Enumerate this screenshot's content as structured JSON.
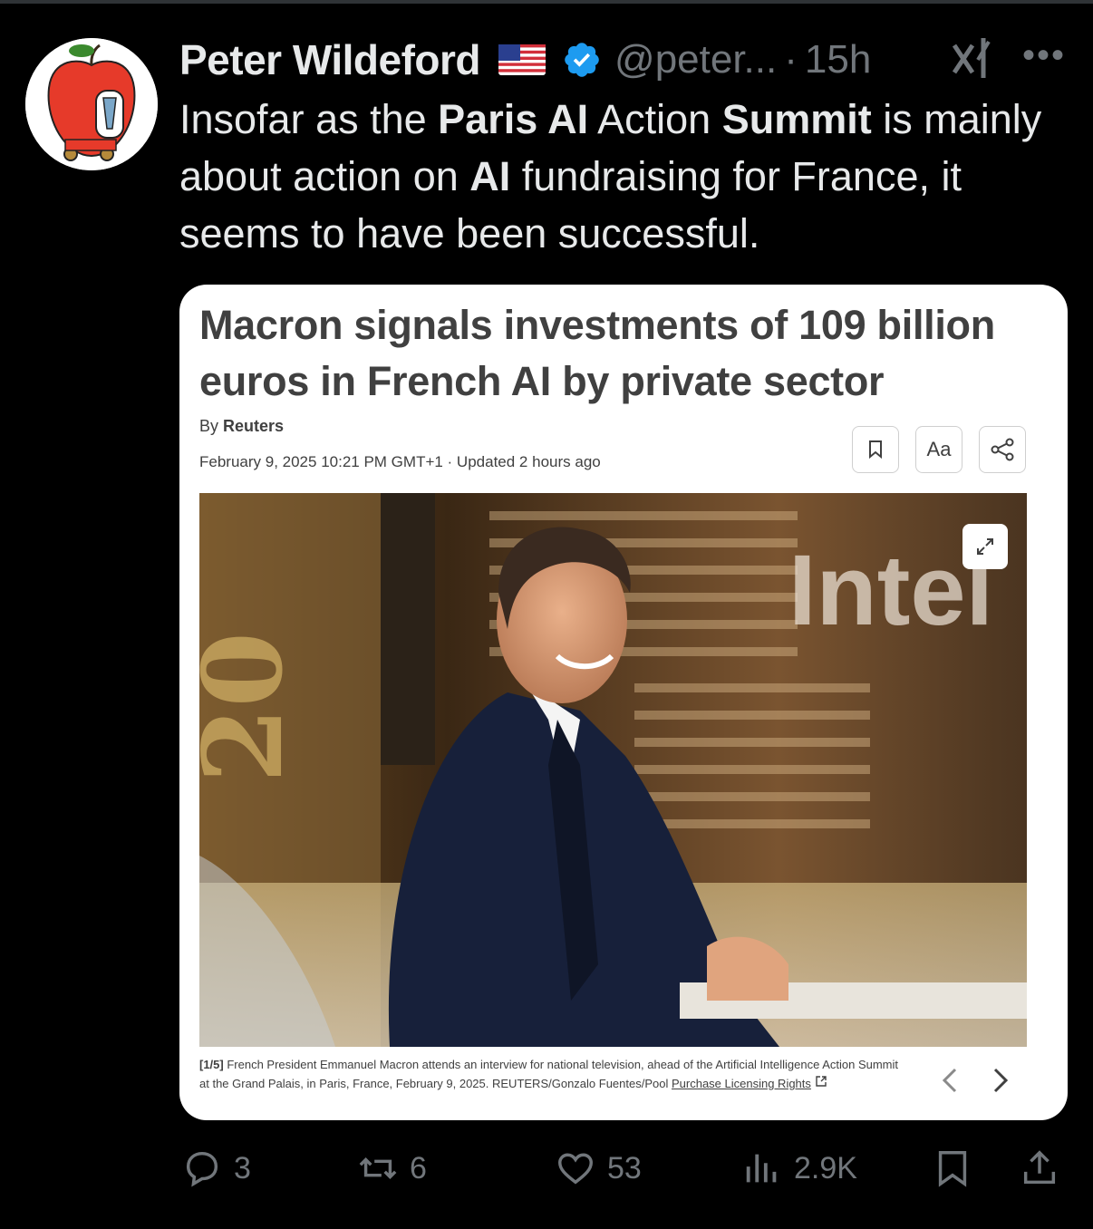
{
  "tweet": {
    "author_name": "Peter Wildeford",
    "handle": "@peter...",
    "separator": "·",
    "time": "15h",
    "text_parts": [
      {
        "t": "Insofar as the ",
        "b": false
      },
      {
        "t": "Paris AI",
        "b": true
      },
      {
        "t": " Action ",
        "b": false
      },
      {
        "t": "Summit",
        "b": true
      },
      {
        "t": " is mainly about action on ",
        "b": false
      },
      {
        "t": "AI",
        "b": true
      },
      {
        "t": " fundraising for France, it seems to have been successful.",
        "b": false
      }
    ]
  },
  "card": {
    "headline": "Macron signals investments of 109 billion euros in French AI by private sector",
    "by_prefix": "By ",
    "by_source": "Reuters",
    "dateline": "February 9, 2025 10:21 PM GMT+1 · Updated 2 hours ago",
    "font_button_label": "Aa",
    "caption_index": "[1/5]",
    "caption_text": " French President Emmanuel Macron attends an interview for national television, ahead of the Artificial Intelligence Action Summit at the Grand Palais, in Paris, France, February 9, 2025. REUTERS/Gonzalo Fuentes/Pool ",
    "caption_link": "Purchase Licensing Rights",
    "photo_bg_text": "20",
    "photo_sign_text": "Intel"
  },
  "actions": {
    "replies": "3",
    "reposts": "6",
    "likes": "53",
    "views": "2.9K"
  },
  "colors": {
    "background": "#000000",
    "text": "#e7e9ea",
    "muted": "#71767b",
    "verified": "#1d9bf0",
    "card_bg": "#ffffff",
    "card_text": "#404040"
  }
}
